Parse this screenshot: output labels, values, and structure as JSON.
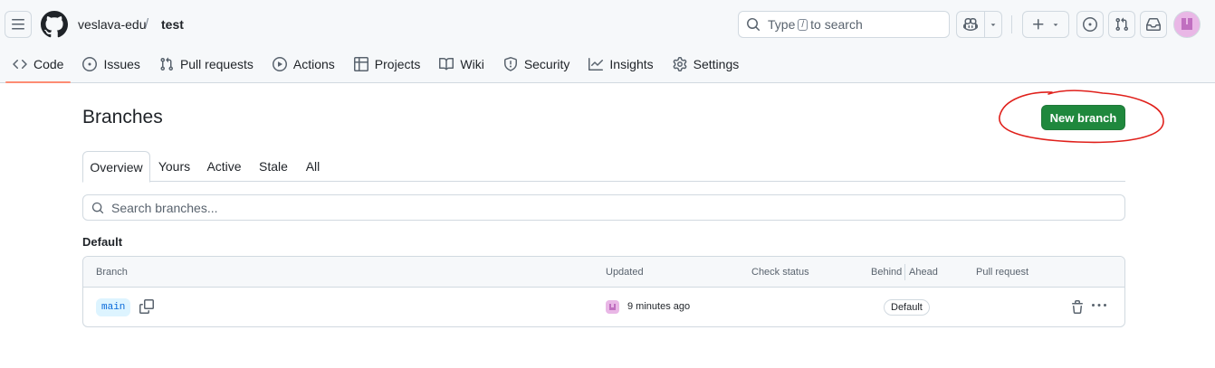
{
  "header": {
    "owner": "veslava-edu",
    "separator": "/",
    "repo": "test",
    "search": {
      "prefix": "Type",
      "key": "/",
      "suffix": "to search"
    }
  },
  "nav": {
    "items": [
      {
        "label": "Code",
        "icon": "code-icon",
        "active": true
      },
      {
        "label": "Issues",
        "icon": "issue-icon"
      },
      {
        "label": "Pull requests",
        "icon": "pull-request-icon"
      },
      {
        "label": "Actions",
        "icon": "play-icon"
      },
      {
        "label": "Projects",
        "icon": "table-icon"
      },
      {
        "label": "Wiki",
        "icon": "book-icon"
      },
      {
        "label": "Security",
        "icon": "shield-icon"
      },
      {
        "label": "Insights",
        "icon": "graph-icon"
      },
      {
        "label": "Settings",
        "icon": "gear-icon"
      }
    ]
  },
  "page": {
    "title": "Branches",
    "new_branch_label": "New branch"
  },
  "tabs": [
    "Overview",
    "Yours",
    "Active",
    "Stale",
    "All"
  ],
  "branch_search": {
    "placeholder": "Search branches..."
  },
  "section": {
    "label": "Default"
  },
  "table": {
    "columns": {
      "branch": "Branch",
      "updated": "Updated",
      "check_status": "Check status",
      "behind": "Behind",
      "ahead": "Ahead",
      "pull_request": "Pull request"
    },
    "rows": [
      {
        "branch": "main",
        "updated": "9 minutes ago",
        "badge": "Default"
      }
    ]
  },
  "colors": {
    "primary_button": "#1f883d",
    "active_tab_underline": "#fd8c73",
    "branch_pill_bg": "#ddf4ff",
    "branch_pill_text": "#0969da",
    "annotation": "#e0201b"
  }
}
